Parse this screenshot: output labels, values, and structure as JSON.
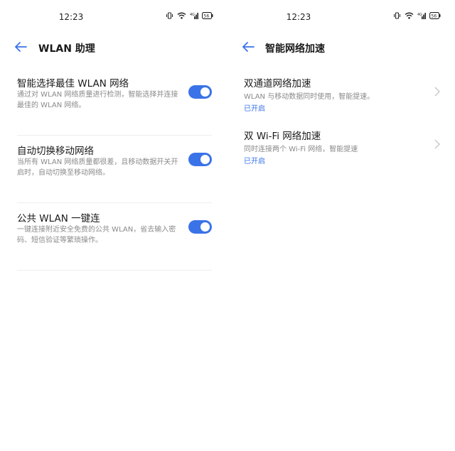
{
  "left": {
    "status": {
      "time": "12:23",
      "battery": "56"
    },
    "header": {
      "title": "WLAN 助理"
    },
    "items": [
      {
        "title": "智能选择最佳 WLAN 网络",
        "desc": "通过对 WLAN 网络质量进行检测，智能选择并连接最佳的 WLAN 网络。",
        "enabled": true
      },
      {
        "title": "自动切换移动网络",
        "desc": "当所有 WLAN 网络质量都很差，且移动数据开关开启时，自动切换至移动网络。",
        "enabled": true
      },
      {
        "title": "公共 WLAN 一键连",
        "desc": "一键连接附近安全免费的公共 WLAN，省去输入密码、短信验证等繁琐操作。",
        "enabled": true
      }
    ]
  },
  "right": {
    "status": {
      "time": "12:23",
      "battery": "56"
    },
    "header": {
      "title": "智能网络加速"
    },
    "items": [
      {
        "title": "双通道网络加速",
        "desc": "WLAN 与移动数据同时使用，智能提速。",
        "status": "已开启"
      },
      {
        "title": "双 Wi-Fi 网络加速",
        "desc": "同时连接两个 Wi-Fi 网络，智能提速",
        "status": "已开启"
      }
    ]
  },
  "colors": {
    "accent": "#3a73e8",
    "divider": "#eeeeee",
    "secondary_text": "#8a8a8a"
  }
}
